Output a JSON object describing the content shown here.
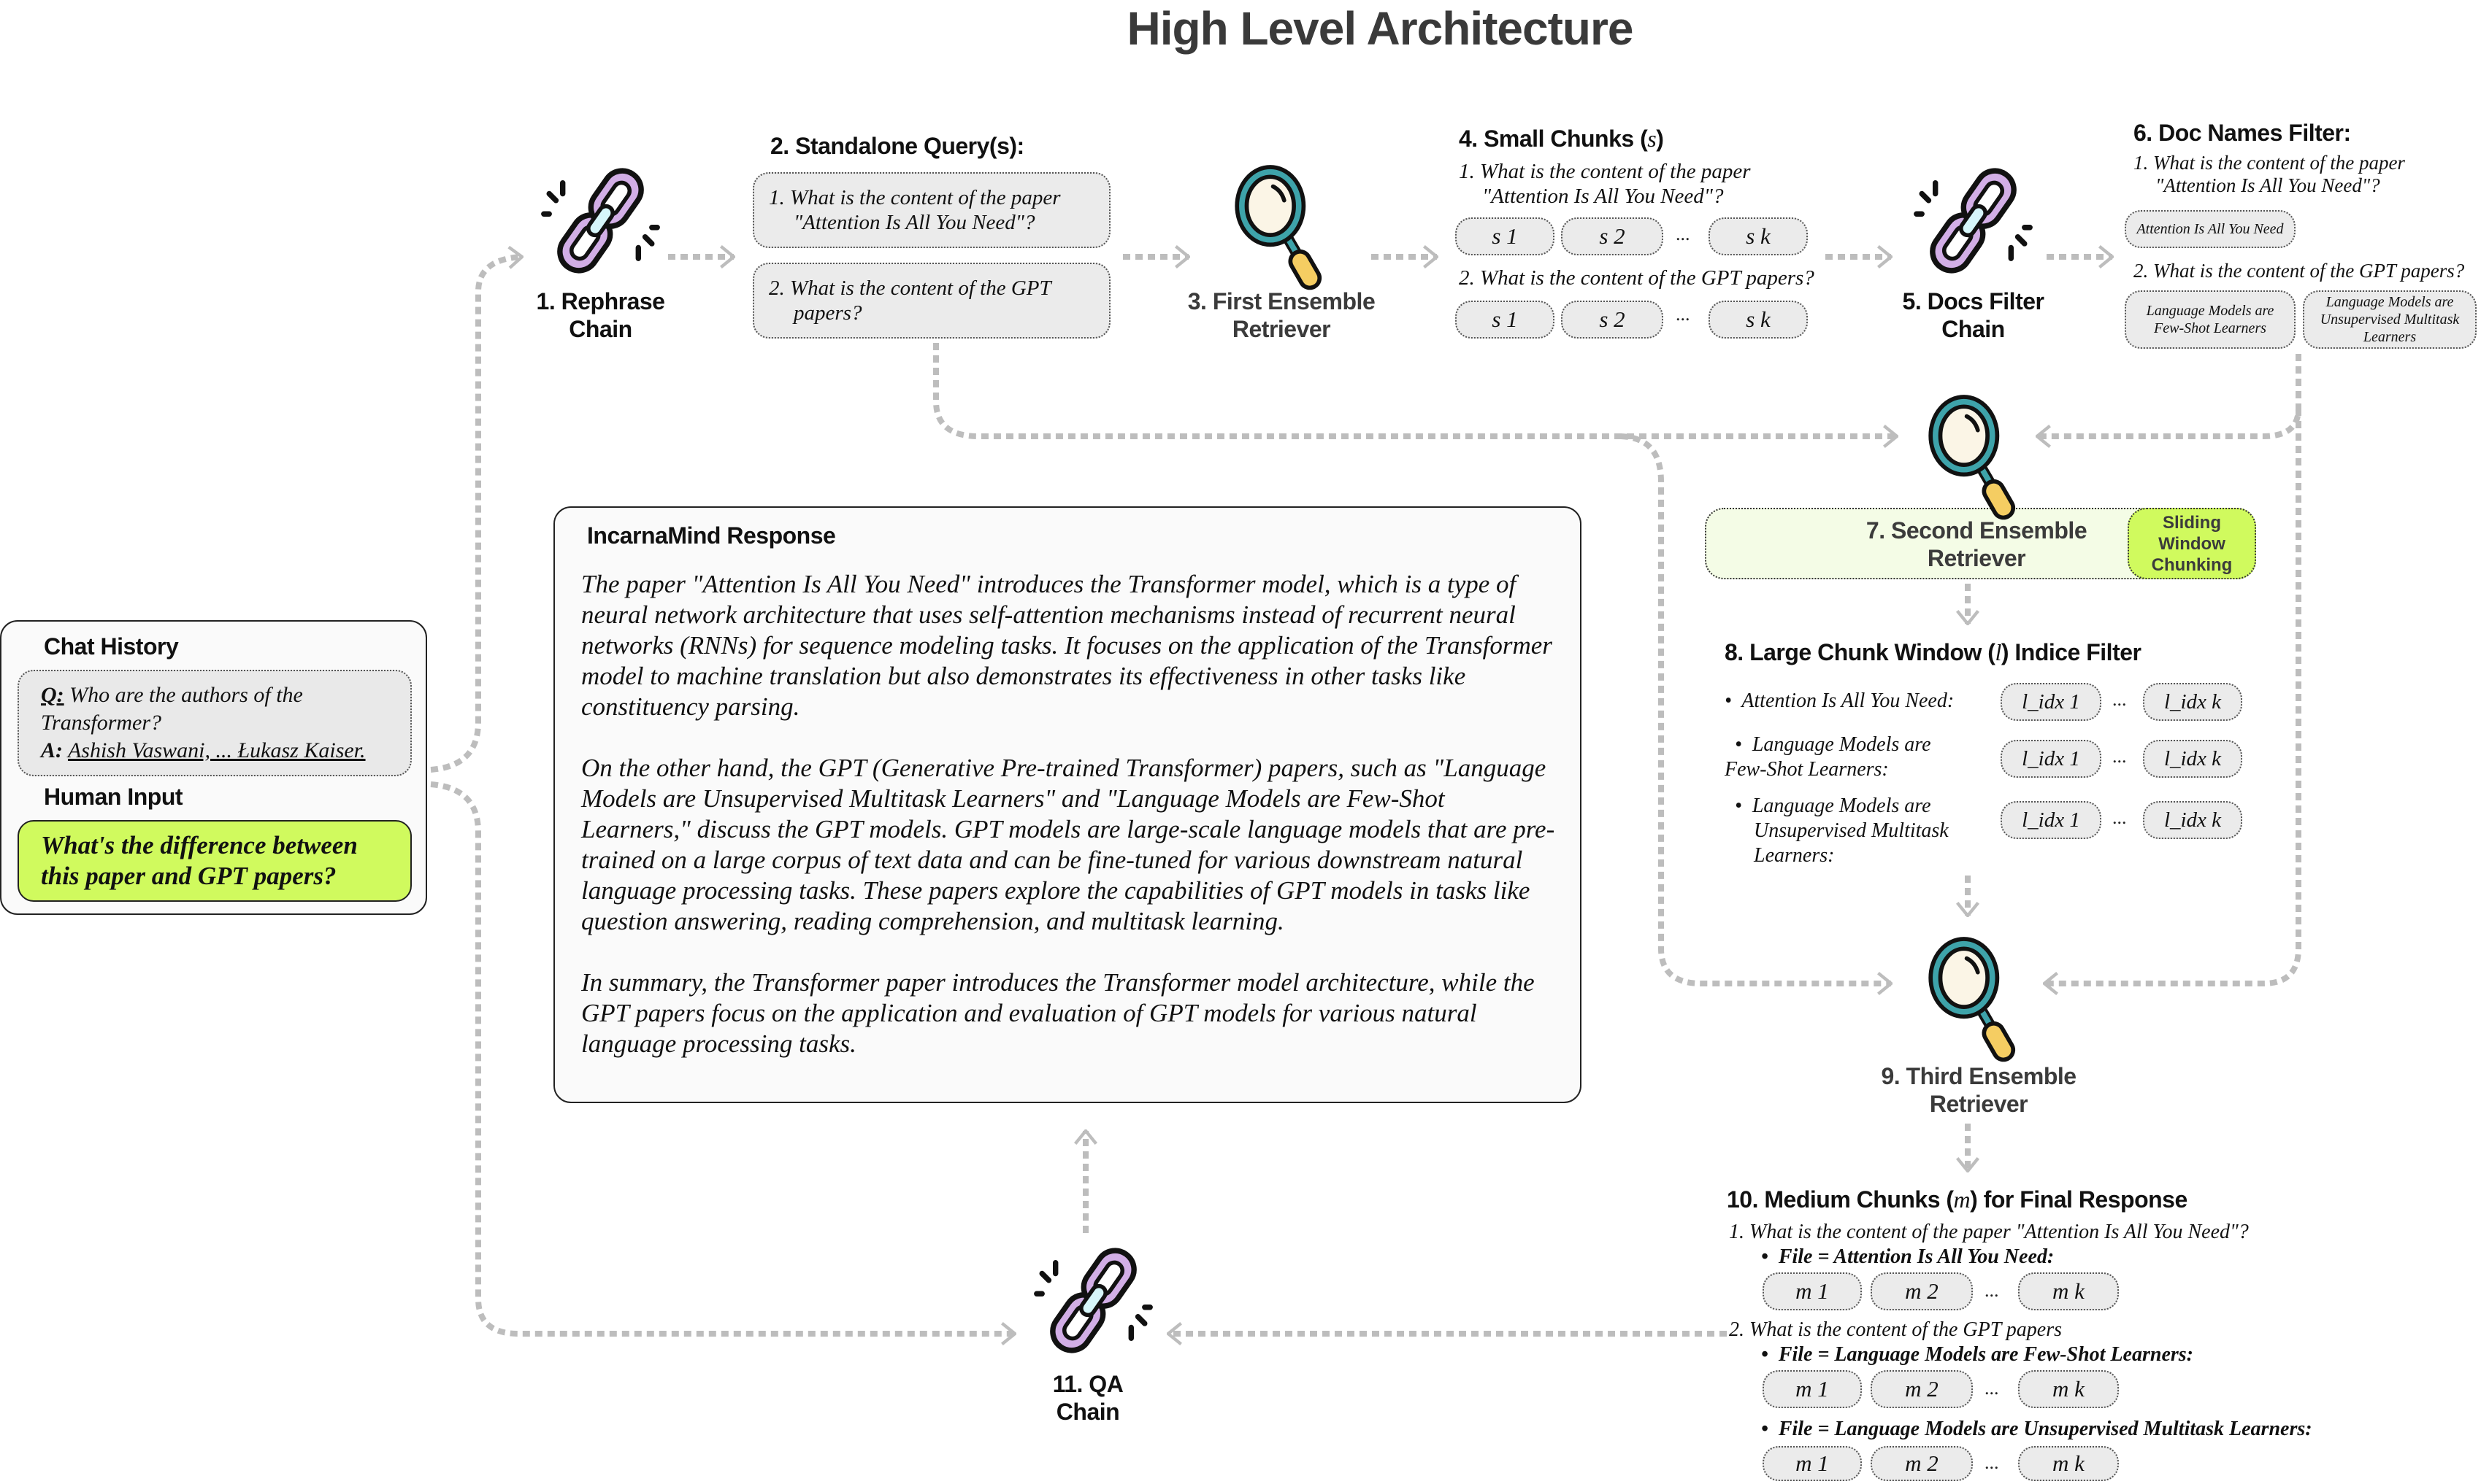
{
  "title": "High Level Architecture",
  "colors": {
    "chain_purple": "#d2aee6",
    "chain_link": "#d6f6fa",
    "magnifier_ring": "#3ea3aa",
    "magnifier_lens": "#fbf5e6",
    "magnifier_handle": "#f5cd62",
    "highlight_green": "#d0fa5e",
    "pale_green": "#f4fce6",
    "chip_grey": "#ebebeb",
    "connector_grey": "#bdbdbd"
  },
  "chat": {
    "history_label": "Chat History",
    "q_prefix": "Q:",
    "q_text": "Who are the authors of the Transformer?",
    "a_prefix": "A:",
    "a_text": "Ashish Vaswani, ... Łukasz Kaiser.",
    "human_input_label": "Human Input",
    "human_input_text": "What's the difference between this paper and GPT papers?"
  },
  "nodes": {
    "rephrase": {
      "line1": "1. Rephrase",
      "line2": "Chain",
      "icon": "chain-link-icon"
    },
    "first_retriever": {
      "line1": "3. First Ensemble",
      "line2": "Retriever",
      "icon": "magnifier-icon"
    },
    "docs_filter": {
      "line1": "5. Docs Filter",
      "line2": "Chain",
      "icon": "chain-link-icon"
    },
    "second_retriever": {
      "line1": "7. Second Ensemble",
      "line2": "Retriever",
      "badge": [
        "Sliding",
        "Window",
        "Chunking"
      ],
      "icon": "magnifier-icon"
    },
    "third_retriever": {
      "line1": "9. Third Ensemble",
      "line2": "Retriever",
      "icon": "magnifier-icon"
    },
    "qa": {
      "line1": "11. QA",
      "line2": "Chain",
      "icon": "chain-link-icon"
    }
  },
  "standalone": {
    "heading": "2. Standalone Query(s):",
    "queries": [
      {
        "line1": "1.  What is the content of the paper",
        "line2": "\"Attention Is All You Need\"?"
      },
      {
        "line1": "2.  What is the content of the GPT",
        "line2": "papers?"
      }
    ]
  },
  "small_chunks": {
    "heading": "4. Small Chunks (",
    "heading_var": "s",
    "heading_end": ")",
    "q1_line1": "1.  What is the content of the paper",
    "q1_line2": "\"Attention Is All You Need\"?",
    "q2": "2.  What is the content of the GPT papers?",
    "chips": [
      "s 1",
      "s 2",
      "s k"
    ],
    "ellipsis": "..."
  },
  "doc_names": {
    "heading": "6. Doc Names Filter:",
    "q1_line1": "1.  What is the content of the paper",
    "q1_line2": "\"Attention Is All You Need\"?",
    "q2": "2.  What is the content of the GPT papers?",
    "doc1": "Attention Is All You Need",
    "doc2": "Language Models are Few-Shot Learners",
    "doc3": "Language Models are Unsupervised Multitask Learners"
  },
  "large_chunks": {
    "heading": "8. Large Chunk Window (",
    "heading_var": "l",
    "heading_end": ") Indice Filter",
    "rows": [
      {
        "label": "Attention Is All You Need:",
        "first": "l_idx 1",
        "last": "l_idx k"
      },
      {
        "label": "Language Models are Few-Shot Learners:",
        "first": "l_idx 1",
        "last": "l_idx k"
      },
      {
        "label": "Language Models are Unsupervised Multitask Learners:",
        "first": "l_idx 1",
        "last": "l_idx k"
      }
    ],
    "ellipsis": "..."
  },
  "medium_chunks": {
    "heading": "10. Medium Chunks (",
    "heading_var": "m",
    "heading_end": ") for Final Response",
    "q1": "1. What is the content of the paper \"Attention Is All You Need\"?",
    "file1": "File = Attention Is All You Need:",
    "q2": "2. What is the content of the GPT papers",
    "file2": "File = Language Models are Few-Shot Learners:",
    "file3": "File = Language Models are Unsupervised Multitask Learners:",
    "chips": [
      "m 1",
      "m 2",
      "m k"
    ],
    "ellipsis": "..."
  },
  "response": {
    "heading": "IncarnaMind Response",
    "paragraphs": [
      "The paper \"Attention Is All You Need\" introduces the Transformer model, which is a type of neural network architecture that uses self-attention mechanisms instead of recurrent neural networks (RNNs) for sequence modeling tasks. It focuses on the application of the Transformer model to machine translation but also demonstrates its effectiveness in other tasks like constituency parsing.",
      "On the other hand, the GPT (Generative Pre-trained Transformer) papers, such as \"Language Models are Unsupervised Multitask Learners\" and \"Language Models are Few-Shot Learners,\" discuss the GPT models. GPT models are large-scale language models that are pre-trained on a large corpus of text data and can be fine-tuned for various downstream natural language processing tasks. These papers explore the capabilities of GPT models in tasks like question answering, reading comprehension, and multitask learning.",
      "In summary, the Transformer paper introduces the Transformer model architecture, while the GPT papers focus on the application and evaluation of GPT models for various natural language processing tasks."
    ]
  }
}
